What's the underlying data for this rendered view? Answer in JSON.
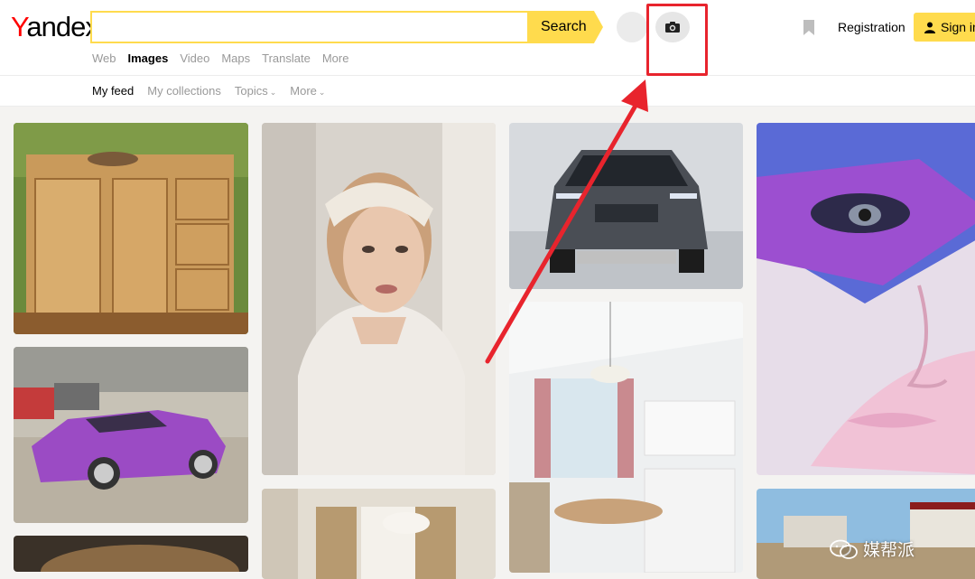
{
  "brand": {
    "logo_first": "Y",
    "logo_rest": "andex"
  },
  "search": {
    "placeholder": "",
    "button_label": "Search"
  },
  "nav": {
    "items": [
      "Web",
      "Images",
      "Video",
      "Maps",
      "Translate",
      "More"
    ],
    "active": "Images"
  },
  "header_right": {
    "registration_label": "Registration",
    "signin_label": "Sign in"
  },
  "subnav": {
    "my_feed": "My feed",
    "my_collections": "My collections",
    "topics": "Topics",
    "more": "More"
  },
  "icons": {
    "camera": "camera-icon",
    "bookmark": "bookmark-icon",
    "user": "user-icon",
    "watermark": "wechat-icon"
  },
  "images": [
    {
      "label": "rustic wooden cabinet"
    },
    {
      "label": "purple sports car"
    },
    {
      "label": "woman in lace"
    },
    {
      "label": "grey SUV"
    },
    {
      "label": "white kitchen"
    },
    {
      "label": "colorful makeup face"
    },
    {
      "label": "living room"
    },
    {
      "label": "warehouse"
    },
    {
      "label": "person hair"
    }
  ],
  "watermark": {
    "text": "媒帮派"
  },
  "colors": {
    "accent": "#ffdb4d",
    "highlight": "#e8242d",
    "logo_red": "#ff0000"
  }
}
